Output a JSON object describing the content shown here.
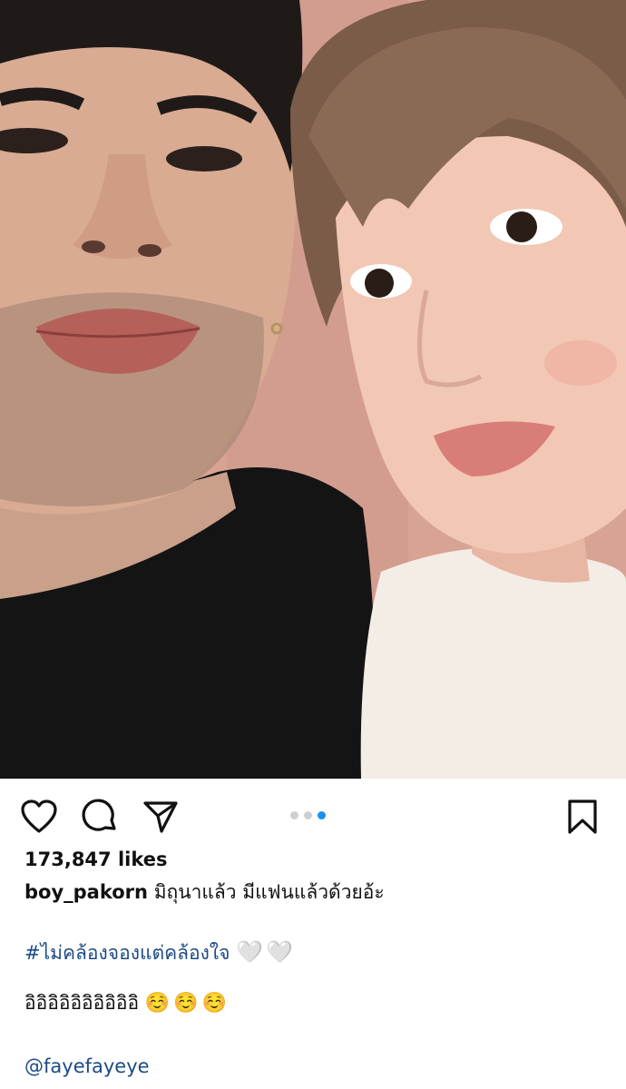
{
  "post": {
    "likes": "173,847 likes",
    "username": "boy_pakorn",
    "caption_text": "มิถุนาแล้ว มีแฟนแล้วด้วยอ้ะ",
    "hashtag": "#ไม่คล้องจองแต่คล้องใจ",
    "hearts": "🤍🤍",
    "thai_expression": "อิอิอิอิอิอิอิอิอิอิ",
    "smileys": "☺️☺️☺️",
    "mention": "@fayefayeye"
  },
  "carousel": {
    "dots_total": 3,
    "active_index": 2
  },
  "icons": {
    "like": "heart-icon",
    "comment": "comment-icon",
    "share": "share-icon",
    "save": "bookmark-icon"
  },
  "colors": {
    "link": "#1c4b85",
    "active_dot": "#1a8ff5",
    "inactive_dot": "#cfcfcf"
  }
}
